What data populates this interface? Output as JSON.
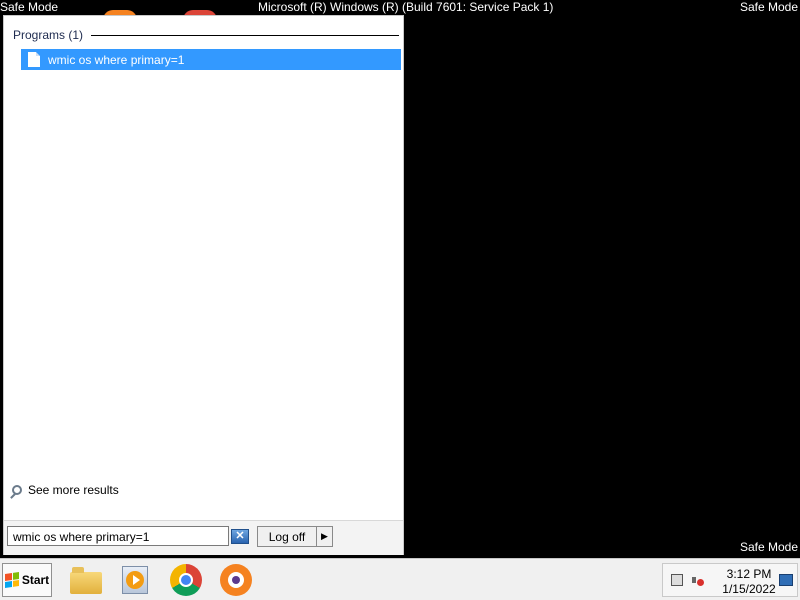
{
  "screen": {
    "safe_mode_label": "Safe Mode",
    "os_title": "Microsoft (R) Windows (R) (Build 7601: Service Pack 1)"
  },
  "start_menu": {
    "programs_header": "Programs (1)",
    "results": [
      {
        "label": "wmic os where primary=1",
        "icon": "file-icon"
      }
    ],
    "see_more": "See more results",
    "search": {
      "value": "wmic os where primary=1"
    },
    "clear_icon": "close-icon",
    "log_off_label": "Log off"
  },
  "taskbar": {
    "start_label": "Start",
    "apps": [
      {
        "name": "Windows Explorer",
        "icon": "folder-icon"
      },
      {
        "name": "Windows Media Player",
        "icon": "media-player-icon"
      },
      {
        "name": "Google Chrome",
        "icon": "chrome-icon"
      },
      {
        "name": "Avast",
        "icon": "avast-icon"
      }
    ],
    "clock": {
      "time": "3:12 PM",
      "date": "1/15/2022"
    }
  },
  "colors": {
    "selection": "#3399ff",
    "desktop": "#000000"
  }
}
